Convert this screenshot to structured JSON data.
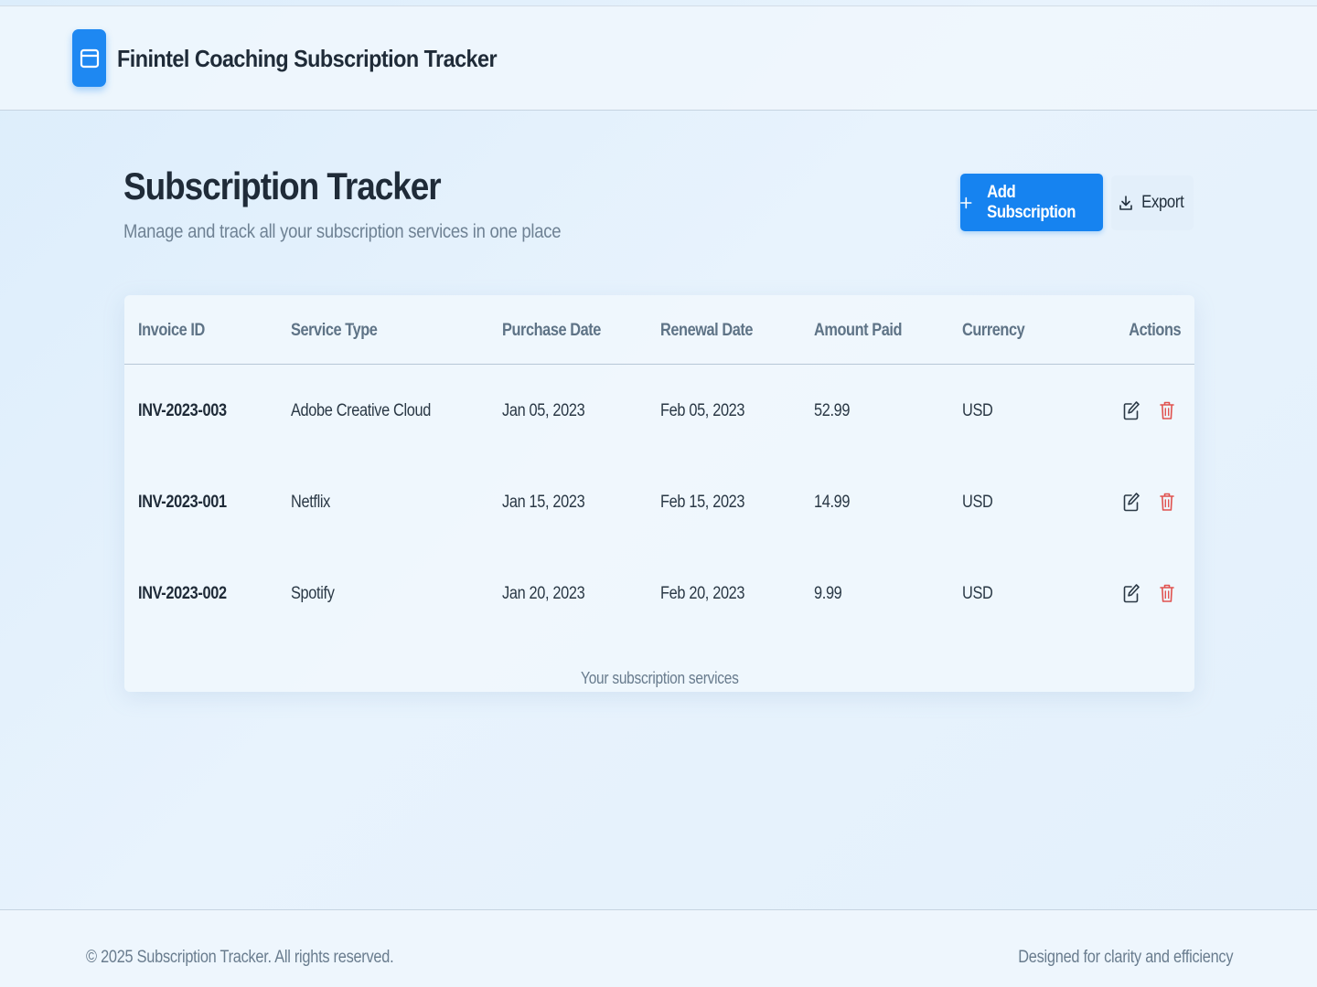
{
  "header": {
    "app_title": "Finintel Coaching Subscription Tracker",
    "logo_icon": "window-icon"
  },
  "page": {
    "title": "Subscription Tracker",
    "subtitle": "Manage and track all your subscription services in one place"
  },
  "toolbar": {
    "add_label": "Add Subscription",
    "add_icon": "plus-icon",
    "export_label": "Export",
    "export_icon": "download-icon"
  },
  "table": {
    "columns": [
      "Invoice ID",
      "Service Type",
      "Purchase Date",
      "Renewal Date",
      "Amount Paid",
      "Currency",
      "Actions"
    ],
    "rows": [
      {
        "invoice_id": "INV-2023-003",
        "service": "Adobe Creative Cloud",
        "purchase": "Jan 05, 2023",
        "renewal": "Feb 05, 2023",
        "amount": "52.99",
        "currency": "USD"
      },
      {
        "invoice_id": "INV-2023-001",
        "service": "Netflix",
        "purchase": "Jan 15, 2023",
        "renewal": "Feb 15, 2023",
        "amount": "14.99",
        "currency": "USD"
      },
      {
        "invoice_id": "INV-2023-002",
        "service": "Spotify",
        "purchase": "Jan 20, 2023",
        "renewal": "Feb 20, 2023",
        "amount": "9.99",
        "currency": "USD"
      }
    ],
    "caption": "Your subscription services",
    "row_actions": {
      "edit_icon": "edit-icon",
      "delete_icon": "trash-icon"
    }
  },
  "footer": {
    "copyright": "© 2025 Subscription Tracker. All rights reserved.",
    "tagline": "Designed for clarity and efficiency"
  },
  "colors": {
    "accent": "#1683f0",
    "delete": "#e0524f",
    "heading": "#1f2b38",
    "muted": "#6f8294"
  }
}
